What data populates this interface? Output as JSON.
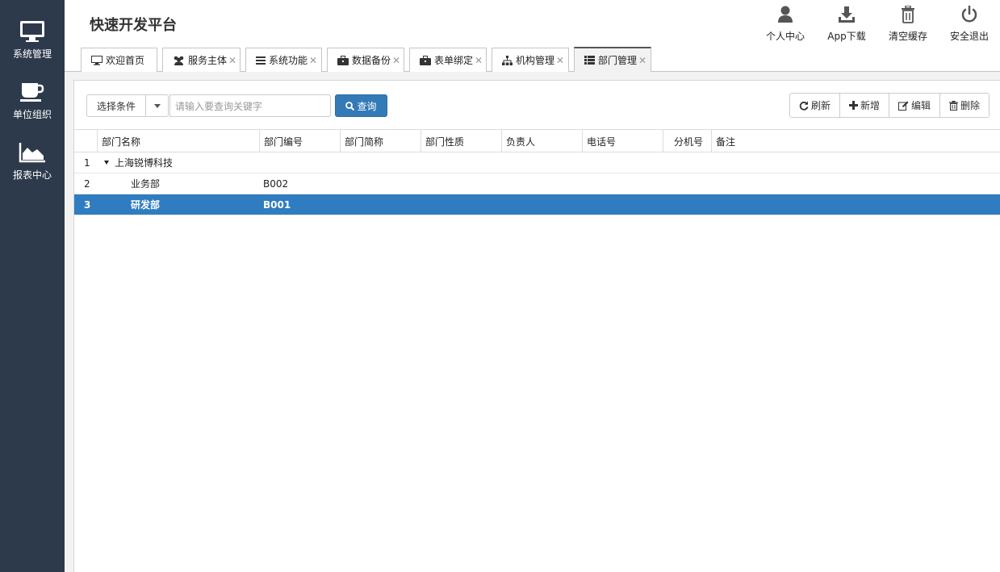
{
  "sidebar": {
    "items": [
      {
        "label": "系统管理",
        "icon": "monitor-icon"
      },
      {
        "label": "单位组织",
        "icon": "coffee-cup-icon"
      },
      {
        "label": "报表中心",
        "icon": "area-chart-icon"
      }
    ]
  },
  "header": {
    "title": "快速开发平台",
    "actions": [
      {
        "label": "个人中心",
        "icon": "user-icon"
      },
      {
        "label": "App下载",
        "icon": "download-icon"
      },
      {
        "label": "清空缓存",
        "icon": "trash-icon"
      },
      {
        "label": "安全退出",
        "icon": "power-icon"
      }
    ]
  },
  "tabs": [
    {
      "label": "欢迎首页",
      "icon": "desktop-icon",
      "closable": false
    },
    {
      "label": "服务主体",
      "icon": "users-icon",
      "closable": true
    },
    {
      "label": "系统功能",
      "icon": "list-icon",
      "closable": true
    },
    {
      "label": "数据备份",
      "icon": "briefcase-icon",
      "closable": true
    },
    {
      "label": "表单绑定",
      "icon": "briefcase-icon",
      "closable": true
    },
    {
      "label": "机构管理",
      "icon": "sitemap-icon",
      "closable": true
    },
    {
      "label": "部门管理",
      "icon": "th-list-icon",
      "closable": true,
      "active": true
    }
  ],
  "toolbar": {
    "select_label": "选择条件",
    "search_placeholder": "请输入要查询关键字",
    "query_label": "查询",
    "refresh_label": "刷新",
    "add_label": "新增",
    "edit_label": "编辑",
    "delete_label": "删除"
  },
  "grid": {
    "columns": [
      "部门名称",
      "部门编号",
      "部门简称",
      "部门性质",
      "负责人",
      "电话号",
      "分机号",
      "备注"
    ],
    "rows": [
      {
        "num": "1",
        "name": "上海锐博科技",
        "code": "",
        "level": 0,
        "expanded": true,
        "selected": false
      },
      {
        "num": "2",
        "name": "业务部",
        "code": "B002",
        "level": 1,
        "selected": false
      },
      {
        "num": "3",
        "name": "研发部",
        "code": "B001",
        "level": 1,
        "selected": true
      }
    ]
  },
  "colors": {
    "sidebar_bg": "#2d3a4b",
    "primary": "#337ab7",
    "selected_row": "#2f7dc0"
  }
}
